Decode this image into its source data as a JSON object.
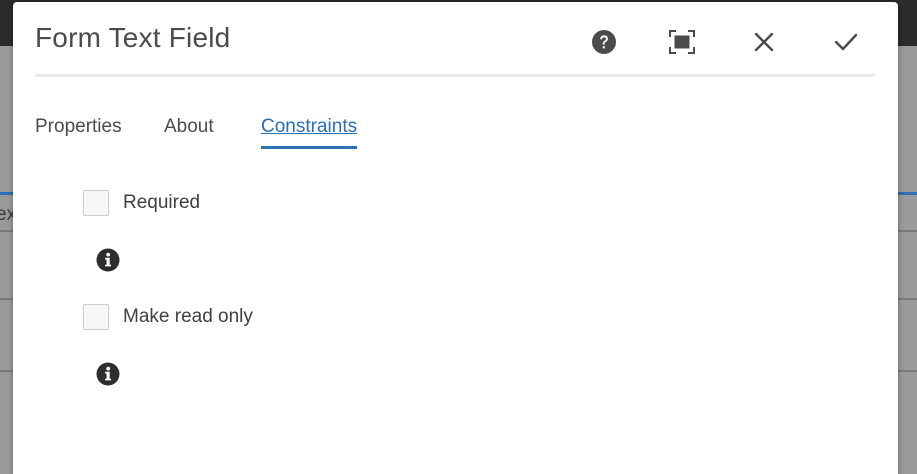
{
  "dialog": {
    "title": "Form Text Field",
    "header_buttons": [
      {
        "name": "help",
        "icon": "help-circle-icon"
      },
      {
        "name": "fullscreen",
        "icon": "fullscreen-icon"
      },
      {
        "name": "close",
        "icon": "close-icon"
      },
      {
        "name": "done",
        "icon": "checkmark-icon"
      }
    ]
  },
  "tabs": [
    {
      "label": "Properties",
      "active": false
    },
    {
      "label": "About",
      "active": false
    },
    {
      "label": "Constraints",
      "active": true
    }
  ],
  "constraints": {
    "required": {
      "label": "Required",
      "checked": false,
      "info_icon": "info-icon"
    },
    "read_only": {
      "label": "Make read only",
      "checked": false,
      "info_icon": "info-icon"
    }
  },
  "backdrop": {
    "partial_text": "ex"
  },
  "colors": {
    "accent": "#2c6fb2",
    "text": "#4b4b4b",
    "topbar": "#2b2b2b",
    "dialog_bg": "#ffffff"
  }
}
